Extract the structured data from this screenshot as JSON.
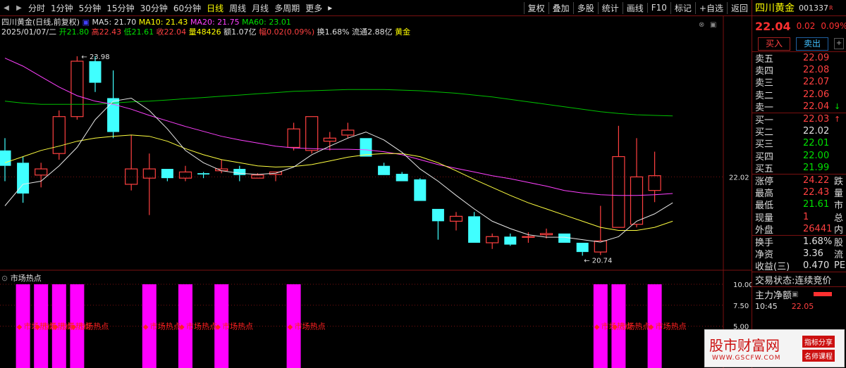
{
  "toolbar": {
    "nav_left": "◀",
    "nav_right": "▶",
    "timeframes": [
      "分时",
      "1分钟",
      "5分钟",
      "15分钟",
      "30分钟",
      "60分钟",
      "日线",
      "周线",
      "月线",
      "多周期",
      "更多"
    ],
    "active_timeframe": "日线",
    "more_arrow": "▸",
    "actions": [
      "复权",
      "叠加",
      "多股",
      "统计",
      "画线",
      "F10",
      "标记",
      "+自选",
      "返回"
    ]
  },
  "info": {
    "name": "四川黄金(日线,前复权)",
    "ma5": "MA5: 21.70",
    "ma10": "MA10: 21.43",
    "ma20": "MA20: 21.75",
    "ma60": "MA60: 23.01",
    "date": "2025/01/07/二",
    "open": "开21.80",
    "high": "高22.43",
    "low": "低21.61",
    "close": "收22.04",
    "volume": "量48426",
    "amount": "额1.07亿",
    "change": "幅0.02(0.09%)",
    "turnover": "换1.68%",
    "float": "流通2.88亿",
    "sector": "黄金"
  },
  "chart": {
    "high_label": "23.98",
    "low_label": "20.74",
    "price_axis": [
      "22.02"
    ],
    "indicator_title": "市场热点",
    "indicator_axis": [
      "10.00",
      "7.50",
      "5.00"
    ],
    "hotspot_label": "市场热点"
  },
  "colors": {
    "up": "#ff4040",
    "down": "#40ffff",
    "ma5": "#e8e8e8",
    "ma10": "#ffff40",
    "ma20": "#ff40ff",
    "ma60": "#00c000",
    "hot": "#ff00ff"
  },
  "chart_data": {
    "type": "candlestick",
    "candles": [
      {
        "o": 22.45,
        "h": 22.65,
        "l": 21.95,
        "c": 22.2
      },
      {
        "o": 22.25,
        "h": 22.35,
        "l": 21.6,
        "c": 21.75
      },
      {
        "o": 22.05,
        "h": 22.25,
        "l": 21.85,
        "c": 22.15
      },
      {
        "o": 22.4,
        "h": 23.1,
        "l": 22.3,
        "c": 23.0
      },
      {
        "o": 23.0,
        "h": 23.98,
        "l": 22.95,
        "c": 23.9
      },
      {
        "o": 23.9,
        "h": 23.98,
        "l": 23.4,
        "c": 23.55
      },
      {
        "o": 23.3,
        "h": 23.75,
        "l": 22.65,
        "c": 22.75
      },
      {
        "o": 21.9,
        "h": 22.7,
        "l": 21.8,
        "c": 22.15
      },
      {
        "o": 22.0,
        "h": 22.4,
        "l": 21.4,
        "c": 22.15
      },
      {
        "o": 22.15,
        "h": 22.15,
        "l": 21.95,
        "c": 22.0
      },
      {
        "o": 22.0,
        "h": 22.2,
        "l": 21.95,
        "c": 22.1
      },
      {
        "o": 22.08,
        "h": 22.1,
        "l": 22.0,
        "c": 22.06
      },
      {
        "o": 22.12,
        "h": 22.3,
        "l": 22.08,
        "c": 22.15
      },
      {
        "o": 22.15,
        "h": 22.2,
        "l": 21.95,
        "c": 22.05
      },
      {
        "o": 22.0,
        "h": 22.08,
        "l": 22.0,
        "c": 22.05
      },
      {
        "o": 22.06,
        "h": 22.1,
        "l": 21.95,
        "c": 22.1
      },
      {
        "o": 22.5,
        "h": 22.9,
        "l": 22.45,
        "c": 22.8
      },
      {
        "o": 22.45,
        "h": 23.0,
        "l": 22.4,
        "c": 23.0
      },
      {
        "o": 22.6,
        "h": 22.75,
        "l": 22.45,
        "c": 22.65
      },
      {
        "o": 22.7,
        "h": 22.9,
        "l": 22.65,
        "c": 22.78
      },
      {
        "o": 22.65,
        "h": 22.65,
        "l": 22.35,
        "c": 22.35
      },
      {
        "o": 22.2,
        "h": 22.25,
        "l": 22.05,
        "c": 22.05
      },
      {
        "o": 22.07,
        "h": 22.1,
        "l": 21.95,
        "c": 21.95
      },
      {
        "o": 21.98,
        "h": 22.0,
        "l": 21.63,
        "c": 21.63
      },
      {
        "o": 21.5,
        "h": 21.5,
        "l": 21.0,
        "c": 21.3
      },
      {
        "o": 21.3,
        "h": 21.45,
        "l": 21.15,
        "c": 21.38
      },
      {
        "o": 21.38,
        "h": 21.45,
        "l": 20.95,
        "c": 20.95
      },
      {
        "o": 20.95,
        "h": 21.1,
        "l": 20.85,
        "c": 21.05
      },
      {
        "o": 21.05,
        "h": 21.1,
        "l": 20.9,
        "c": 20.92
      },
      {
        "o": 21.05,
        "h": 21.12,
        "l": 20.95,
        "c": 21.05
      },
      {
        "o": 21.08,
        "h": 21.18,
        "l": 21.02,
        "c": 21.1
      },
      {
        "o": 21.1,
        "h": 21.1,
        "l": 20.95,
        "c": 20.95
      },
      {
        "o": 20.95,
        "h": 20.95,
        "l": 20.74,
        "c": 20.8
      },
      {
        "o": 20.8,
        "h": 21.55,
        "l": 20.75,
        "c": 20.98
      },
      {
        "o": 21.2,
        "h": 22.85,
        "l": 21.2,
        "c": 22.35
      },
      {
        "o": 21.25,
        "h": 22.65,
        "l": 21.2,
        "c": 22.02
      },
      {
        "o": 21.8,
        "h": 22.43,
        "l": 21.61,
        "c": 22.04
      }
    ],
    "ma5": [
      21.55,
      21.9,
      21.95,
      22.2,
      22.5,
      22.95,
      23.25,
      23.3,
      23.1,
      22.8,
      22.45,
      22.25,
      22.12,
      22.08,
      22.06,
      22.08,
      22.18,
      22.38,
      22.52,
      22.65,
      22.75,
      22.62,
      22.42,
      22.15,
      21.95,
      21.72,
      21.5,
      21.3,
      21.18,
      21.08,
      21.04,
      21.04,
      21.0,
      20.96,
      21.05,
      21.3,
      21.42,
      21.6
    ],
    "ma10": [
      22.25,
      22.35,
      22.45,
      22.52,
      22.6,
      22.65,
      22.68,
      22.7,
      22.68,
      22.6,
      22.48,
      22.38,
      22.3,
      22.25,
      22.2,
      22.18,
      22.19,
      22.22,
      22.28,
      22.34,
      22.38,
      22.4,
      22.4,
      22.35,
      22.25,
      22.12,
      21.98,
      21.85,
      21.72,
      21.6,
      21.5,
      21.4,
      21.3,
      21.2,
      21.15,
      21.15,
      21.2,
      21.3
    ],
    "ma20": [
      23.95,
      23.82,
      23.65,
      23.48,
      23.34,
      23.25,
      23.2,
      23.12,
      23.02,
      22.93,
      22.84,
      22.76,
      22.68,
      22.62,
      22.57,
      22.52,
      22.49,
      22.48,
      22.47,
      22.47,
      22.46,
      22.43,
      22.38,
      22.3,
      22.22,
      22.16,
      22.1,
      22.04,
      21.99,
      21.93,
      21.87,
      21.8,
      21.76,
      21.73,
      21.72,
      21.72,
      21.73,
      21.75
    ],
    "ma60": [
      23.25,
      23.22,
      23.2,
      23.2,
      23.2,
      23.2,
      23.22,
      23.24,
      23.25,
      23.27,
      23.29,
      23.31,
      23.33,
      23.35,
      23.37,
      23.39,
      23.41,
      23.42,
      23.43,
      23.44,
      23.44,
      23.44,
      23.43,
      23.42,
      23.4,
      23.38,
      23.35,
      23.32,
      23.28,
      23.24,
      23.2,
      23.16,
      23.12,
      23.08,
      23.05,
      23.03,
      23.02,
      23.01
    ],
    "ylim": [
      20.55,
      24.3
    ],
    "hotspots": [
      1,
      2,
      3,
      4,
      8,
      10,
      12,
      16,
      33,
      34,
      36
    ],
    "indicator_ylim": [
      0,
      10
    ]
  },
  "panel": {
    "name": "四川黄金",
    "code": "001337",
    "price": "22.04",
    "change": "0.02",
    "pct": "0.09%",
    "buy_btn": "买入",
    "sell_btn": "卖出",
    "asks": [
      {
        "label": "卖五",
        "price": "22.09",
        "vol": ""
      },
      {
        "label": "卖四",
        "price": "22.08",
        "vol": ""
      },
      {
        "label": "卖三",
        "price": "22.07",
        "vol": ""
      },
      {
        "label": "卖二",
        "price": "22.06",
        "vol": ""
      },
      {
        "label": "卖一",
        "price": "22.04",
        "vol": "↓"
      }
    ],
    "bids": [
      {
        "label": "买一",
        "price": "22.03",
        "vol": "↑"
      },
      {
        "label": "买二",
        "price": "22.02",
        "vol": ""
      },
      {
        "label": "买三",
        "price": "22.01",
        "vol": ""
      },
      {
        "label": "买四",
        "price": "22.00",
        "vol": ""
      },
      {
        "label": "买五",
        "price": "21.99",
        "vol": ""
      }
    ],
    "stats": [
      {
        "label": "涨停",
        "value": "24.22",
        "ext": "跌"
      },
      {
        "label": "最高",
        "value": "22.43",
        "ext": "量"
      },
      {
        "label": "最低",
        "value": "21.61",
        "ext": "市"
      },
      {
        "label": "现量",
        "value": "1",
        "ext": "总"
      },
      {
        "label": "外盘",
        "value": "26441",
        "ext": "内"
      }
    ],
    "stats2": [
      {
        "label": "换手",
        "value": "1.68%",
        "ext": "股"
      },
      {
        "label": "净资",
        "value": "3.36",
        "ext": "流"
      },
      {
        "label": "收益(三)",
        "value": "0.470",
        "ext": "PE"
      }
    ],
    "status_label": "交易状态:",
    "status_value": "连续竞价",
    "main_label": "主力净额",
    "last_time": "10:45",
    "last_price": "22.05"
  },
  "watermark": {
    "main": "股市财富网",
    "url": "WWW.GSCFW.COM",
    "tag1": "指标分享",
    "tag2": "名师课程"
  }
}
